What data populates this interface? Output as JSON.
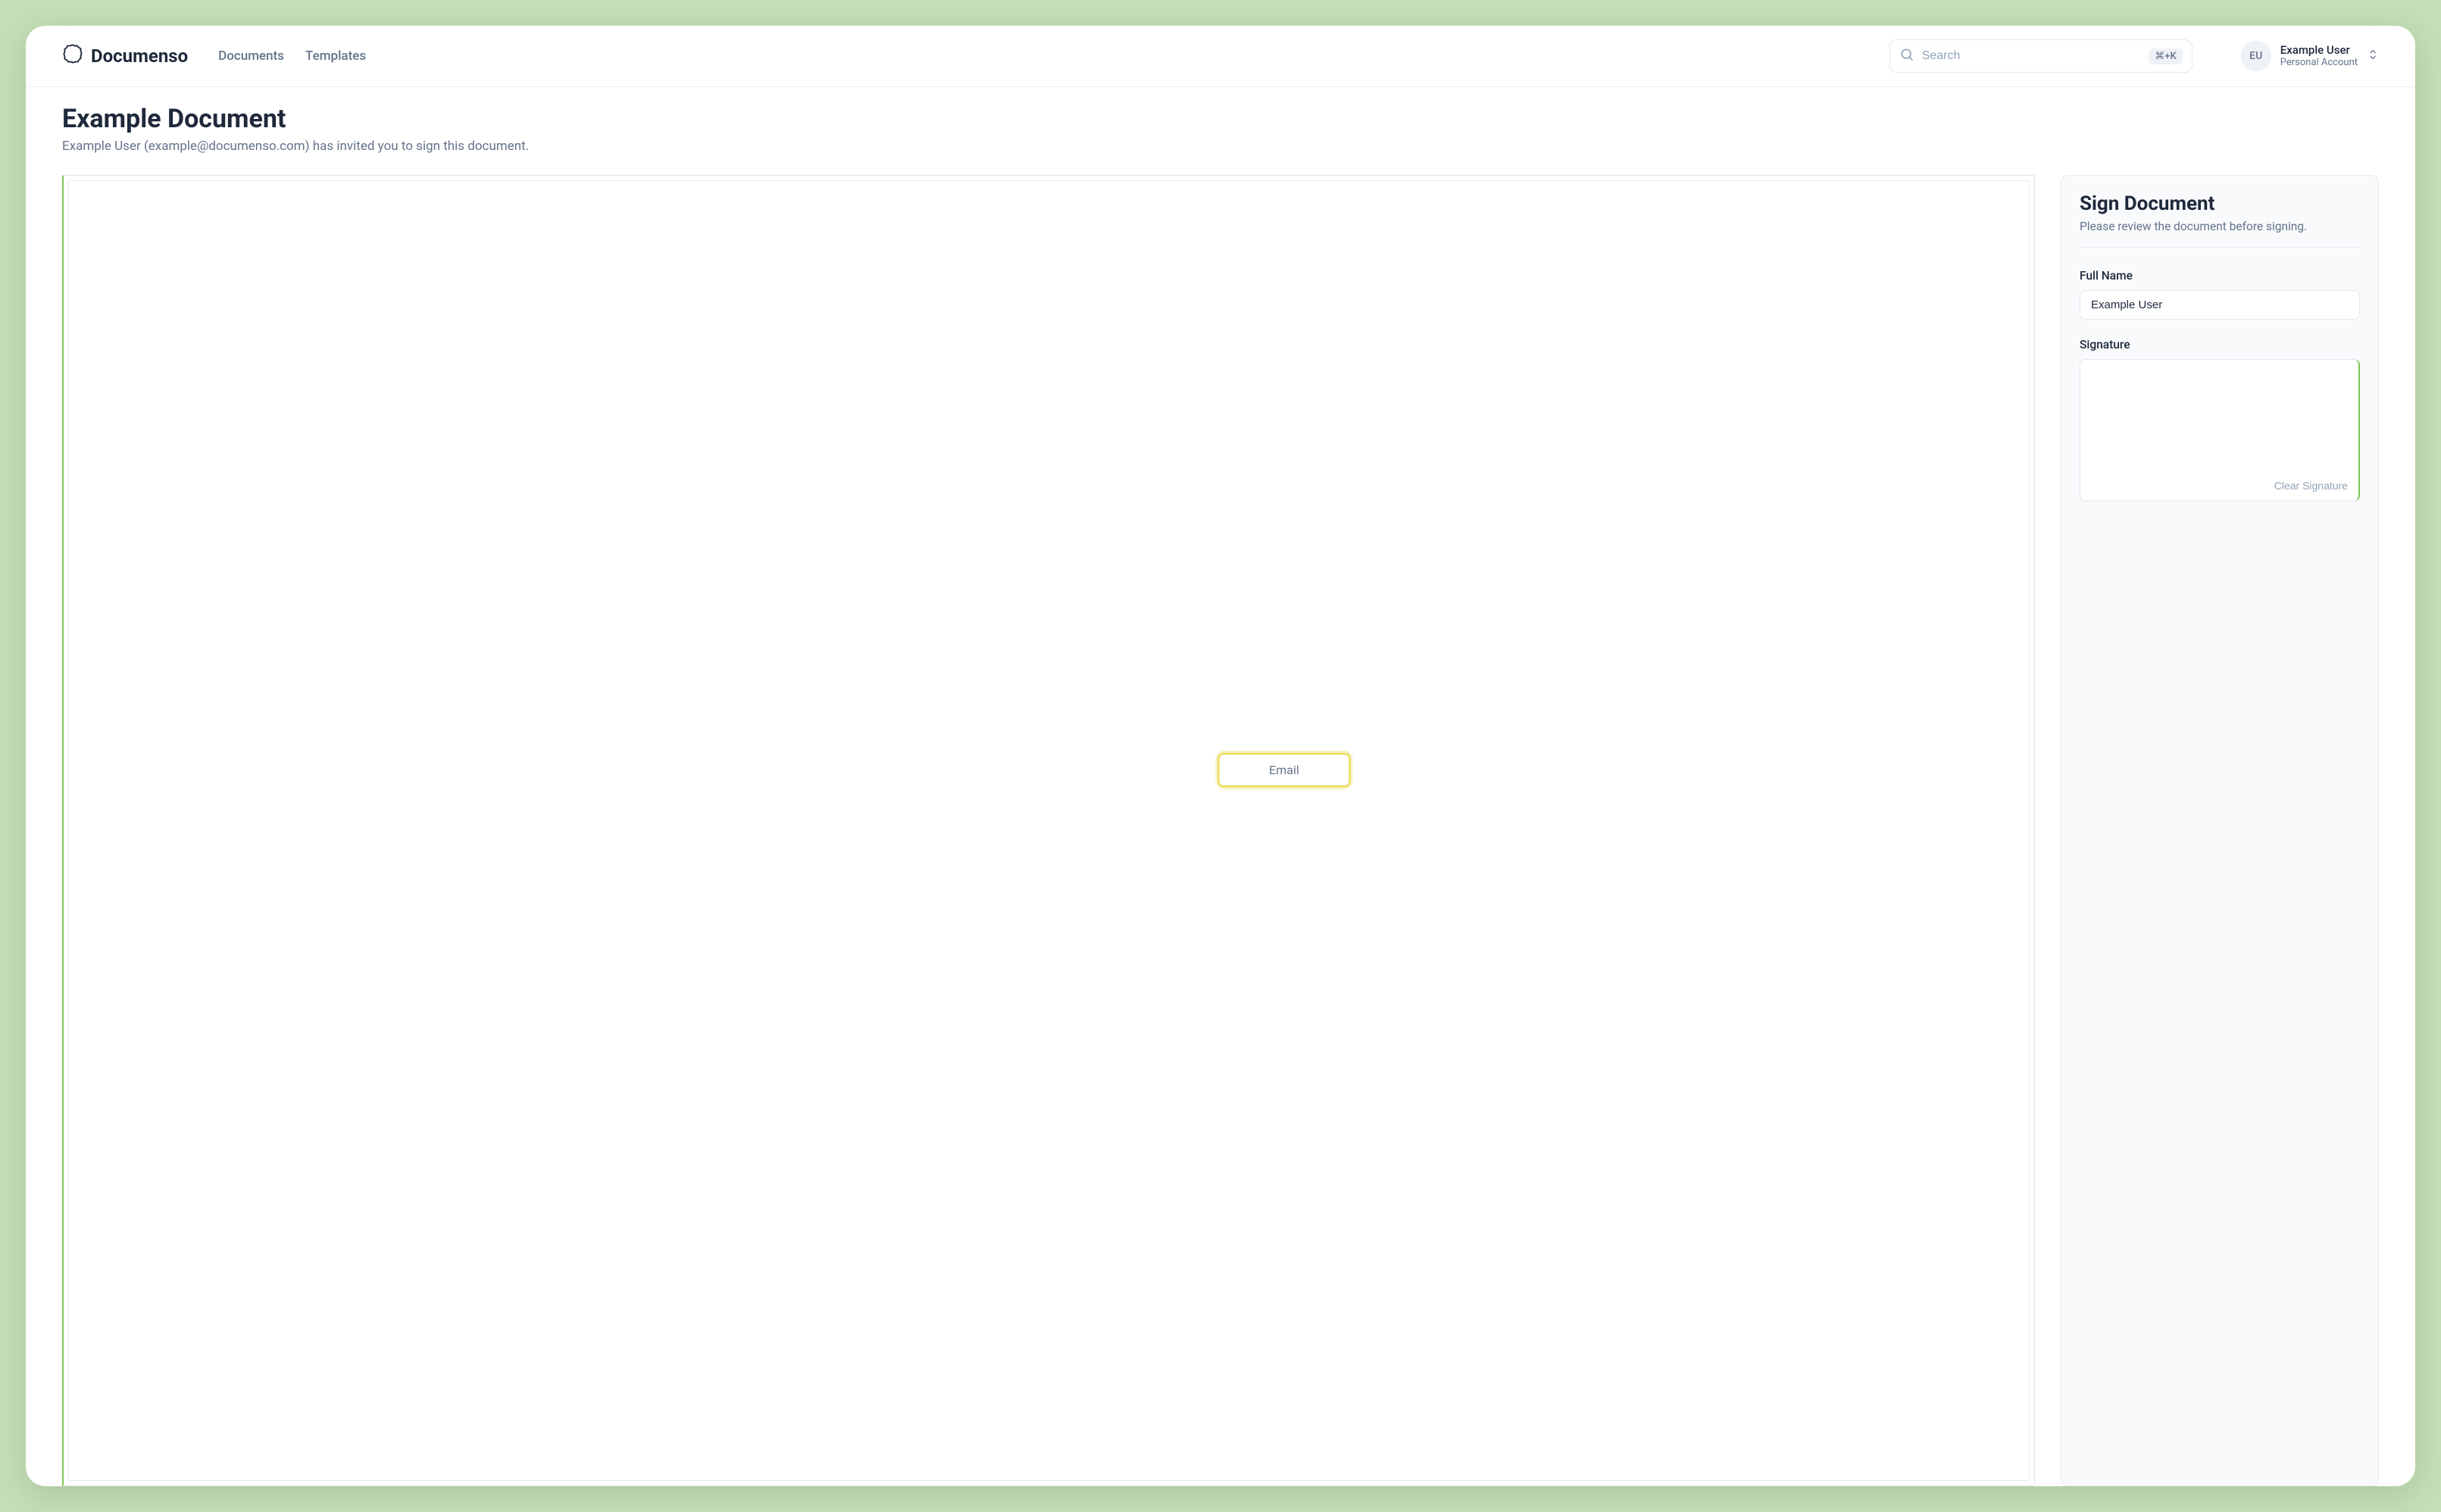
{
  "brand": {
    "name": "Documenso"
  },
  "nav": {
    "documents": "Documents",
    "templates": "Templates"
  },
  "search": {
    "placeholder": "Search",
    "shortcut": "⌘+K"
  },
  "account": {
    "initials": "EU",
    "name": "Example User",
    "subtitle": "Personal Account"
  },
  "page": {
    "title": "Example Document",
    "subtitle": "Example User (example@documenso.com) has invited you to sign this document."
  },
  "viewer": {
    "fields": {
      "email_label": "Email"
    }
  },
  "panel": {
    "title": "Sign Document",
    "subtitle": "Please review the document before signing.",
    "full_name_label": "Full Name",
    "full_name_value": "Example User",
    "signature_label": "Signature",
    "clear_signature": "Clear Signature"
  }
}
